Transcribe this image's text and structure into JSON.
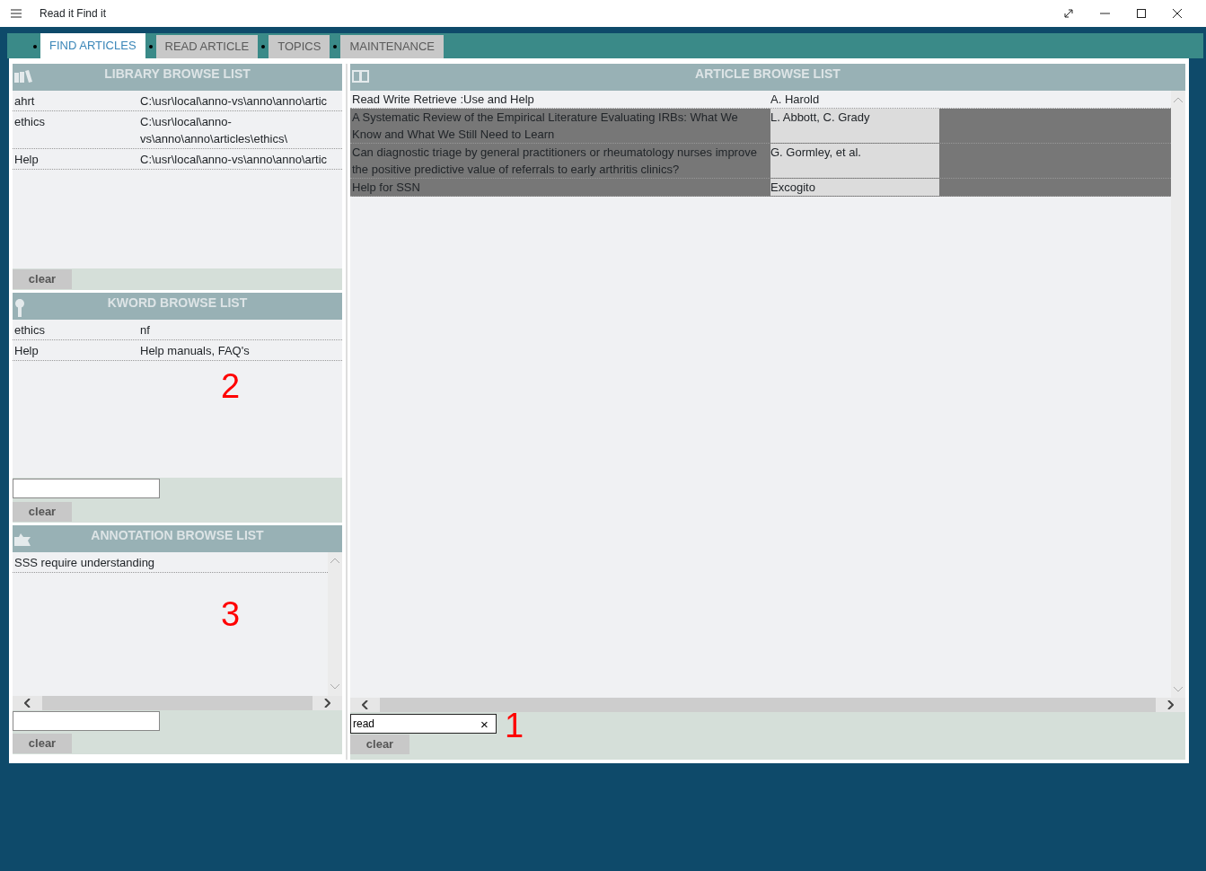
{
  "window": {
    "title": "Read it Find it"
  },
  "tabs": [
    {
      "label": "FIND ARTICLES",
      "selected": true
    },
    {
      "label": "READ ARTICLE",
      "selected": false
    },
    {
      "label": "TOPICS",
      "selected": false
    },
    {
      "label": "MAINTENANCE",
      "selected": false
    }
  ],
  "library": {
    "title": "LIBRARY BROWSE LIST",
    "rows": [
      {
        "name": "ahrt",
        "path": "C:\\usr\\local\\anno-vs\\anno\\anno\\artic"
      },
      {
        "name": "ethics",
        "path": "C:\\usr\\local\\anno-vs\\anno\\anno\\articles\\ethics\\"
      },
      {
        "name": "Help",
        "path": "C:\\usr\\local\\anno-vs\\anno\\anno\\artic"
      }
    ],
    "clear_label": "clear"
  },
  "kword": {
    "title": "KWORD BROWSE LIST",
    "rows": [
      {
        "keyword": "ethics",
        "description": "nf"
      },
      {
        "keyword": "Help",
        "description": "Help manuals, FAQ's"
      }
    ],
    "callout": "2",
    "clear_label": "clear"
  },
  "annotation": {
    "title": "ANNOTATION BROWSE LIST",
    "rows": [
      {
        "text": "SSS require understanding"
      }
    ],
    "callout": "3",
    "clear_label": "clear"
  },
  "articles": {
    "title": "ARTICLE BROWSE LIST",
    "rows": [
      {
        "title": "Read Write Retrieve :Use and Help",
        "author": "A. Harold",
        "selected": false
      },
      {
        "title": "A Systematic Review of the Empirical Literature Evaluating IRBs: What We Know and What We Still Need to Learn",
        "author": "L. Abbott, C. Grady",
        "selected": true
      },
      {
        "title": "Can diagnostic triage by general practitioners or rheumatology nurses improve the positive predictive value of referrals to early arthritis clinics?",
        "author": "G. Gormley, et al.",
        "selected": true
      },
      {
        "title": "Help for SSN",
        "author": "Excogito",
        "selected": true
      }
    ],
    "search": {
      "value": "read",
      "clear_symbol": "×"
    },
    "callout": "1",
    "clear_label": "clear"
  }
}
